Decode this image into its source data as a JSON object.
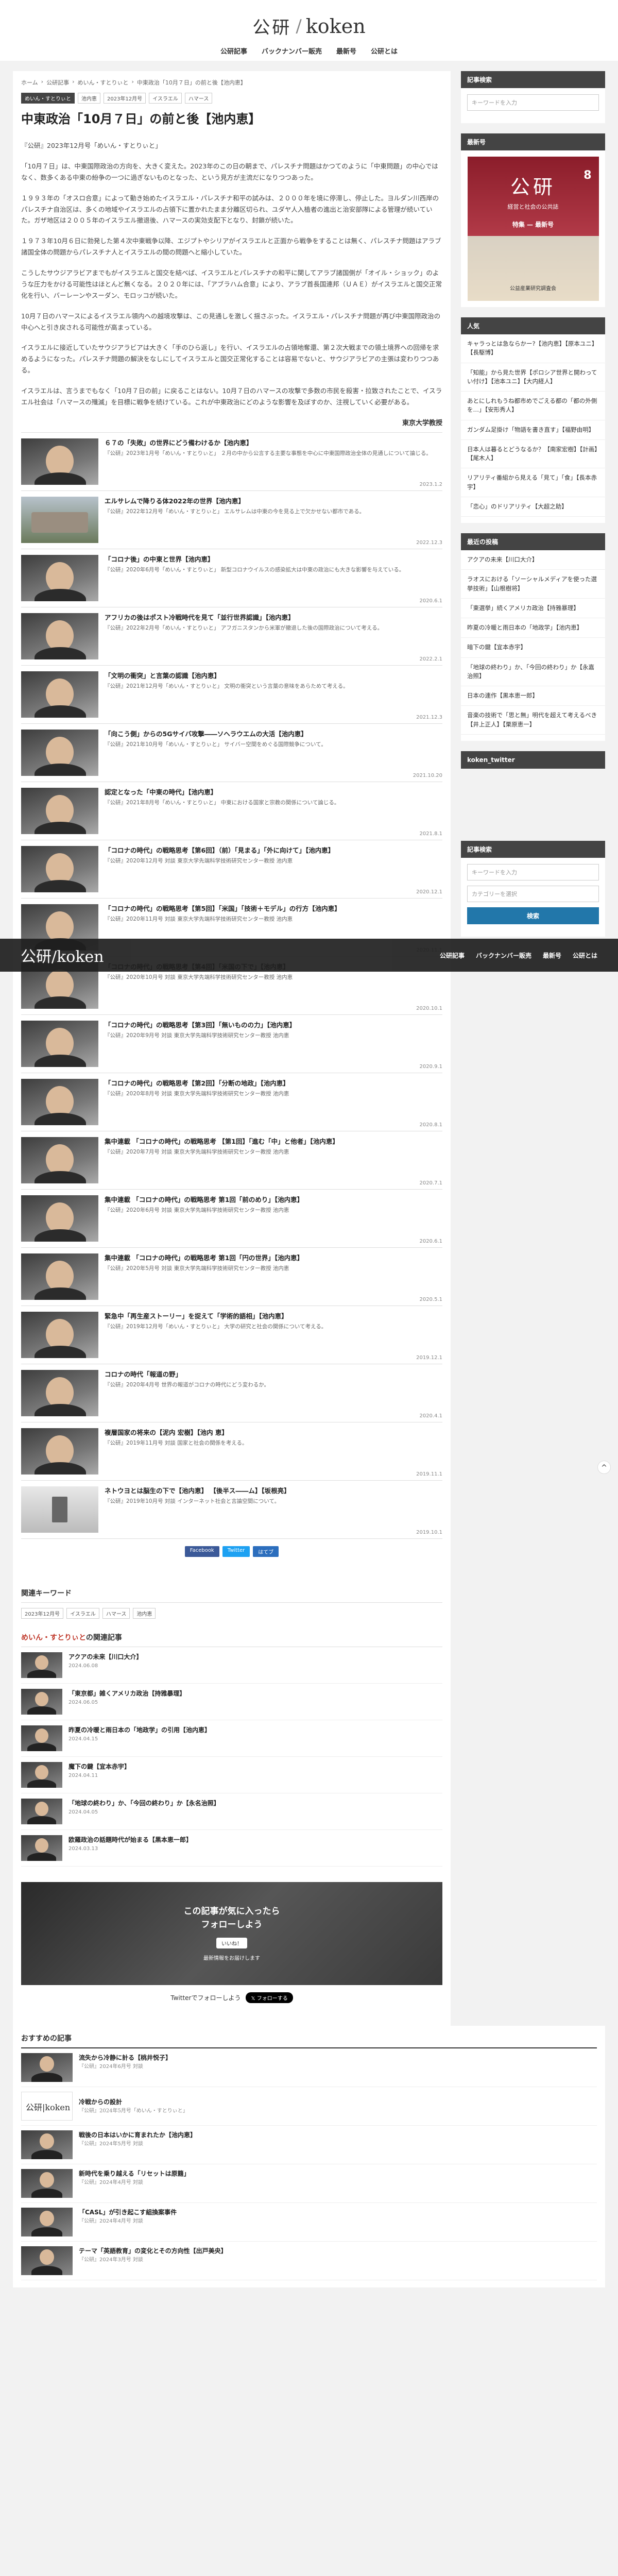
{
  "site": {
    "logo_mark": "公研",
    "logo_sep": "/",
    "logo_text": "koken"
  },
  "nav": [
    "公研記事",
    "バックナンバー販売",
    "最新号",
    "公研とは"
  ],
  "breadcrumb": [
    "ホーム",
    "公研記事",
    "めいん・すとりぃと",
    "中東政治「10月７日」の前と後【池内恵】"
  ],
  "article": {
    "tags": [
      "めいん・すとりぃと",
      "池内恵",
      "2023年12月号",
      "イスラエル",
      "ハマース"
    ],
    "title": "中東政治「10月７日」の前と後【池内恵】",
    "paragraphs": [
      "『公研』2023年12月号「めいん・すとりぃと」",
      "「10月７日」は、中東国際政治の方向を、大きく変えた。2023年のこの日の朝まで、パレスチナ問題はかつてのように「中東問題」の中心ではなく、数多くある中東の紛争の一つに過ぎないものとなった、という見方が主流だになりつつあった。",
      "１９９３年の「オスロ合意」によって動き始めたイスラエル・パレスチナ和平の試みは、２０００年を境に停滞し、停止した。ヨルダン川西岸のパレスチナ自治区は、多くの地域やイスラエルの占領下に置かれたまま分離区切られ、ユダヤ人入植者の進出と治安部隊による管理が続いていた。ガザ地区は２００５年のイスラエル撤退後、ハマースの実効支配下となり、封鎖が続いた。",
      "１９７３年10月６日に勃発した第４次中東戦争以降、エジプトやシリアがイスラエルと正面から戦争をすることは無く、パレスチナ問題はアラブ諸国全体の問題からパレスチナ人とイスラエルの間の問題へと縮小していた。",
      "こうしたサウジアラビアまでもがイスラエルと国交を結べば、イスラエルとパレスチナの和平に関してアラブ諸国側が「オイル・ショック」のような圧力をかける可能性はほとんど無くなる。２０２０年には、「アブラハム合意」により、アラブ首長国連邦（ＵＡＥ）がイスラエルと国交正常化を行い、バーレーンやスーダン、モロッコが続いた。",
      "10月７日のハマースによるイスラエル領内への越境攻撃は、この見通しを激しく揺さぶった。イスラエル・パレスチナ問題が再び中東国際政治の中心へと引き戻される可能性が高まっている。",
      "イスラエルに接近していたサウジアラビアは大きく「手のひら返し」を行い、イスラエルの占領地奪還、第２次大戦までの領土境界への回帰を求めるようになった。パレスチナ問題の解決をなしにしてイスラエルと国交正常化することは容易でないと、サウジアラビアの主張は変わりつつある。",
      "イスラエルは、言うまでもなく「10月７日の前」に戻ることはない。10月７日のハマースの攻撃で多数の市民を殺害・拉致されたことで、イスラエル社会は「ハマースの殲滅」を目標に戦争を続けている。これが中東政治にどのような影響を及ぼすのか、注視していく必要がある。"
    ],
    "author": "東京大学教授"
  },
  "related": [
    {
      "title": "６７の「失敗」の世界にどう備わけるか【池内恵】",
      "desc": "『公研』2023年1月号「めいん・すとりぃと」 ２月の中から公言する主要な事態を中心に中東国際政治全体の見通しについて論じる。",
      "date": "2023.1.2",
      "kind": "face"
    },
    {
      "title": "エルサレムで降りる体2022年の世界【池内恵】",
      "desc": "『公研』2022年12月号「めいん・すとりぃと」 エルサレムは中東の今を見る上で欠かせない都市である。",
      "date": "2022.12.3",
      "kind": "photo"
    },
    {
      "title": "「コロナ後」の中東と世界【池内恵】",
      "desc": "『公研』2020年6月号「めいん・すとりぃと」 新型コロナウイルスの感染拡大は中東の政治にも大きな影響を与えている。",
      "date": "2020.6.1",
      "kind": "face"
    },
    {
      "title": "アフリカの後はポスト冷戦時代を見て「並行世界認識」【池内恵】",
      "desc": "『公研』2022年2月号「めいん・すとりぃと」 アフガニスタンから米軍が撤退した後の国際政治について考える。",
      "date": "2022.2.1",
      "kind": "face"
    },
    {
      "title": "「文明の衝突」と言葉の認識【池内恵】",
      "desc": "『公研』2021年12月号「めいん・すとりぃと」 文明の衝突という言葉の意味をあらためて考える。",
      "date": "2021.12.3",
      "kind": "face"
    },
    {
      "title": "「向こう側」からの5Gサイバ攻撃――ソヘラウエムの大活【池内恵】",
      "desc": "『公研』2021年10月号「めいん・すとりぃと」 サイバー空間をめぐる国際競争について。",
      "date": "2021.10.20",
      "kind": "face"
    },
    {
      "title": "認定となった「中東の時代」【池内恵】",
      "desc": "『公研』2021年8月号「めいん・すとりぃと」 中東における国家と宗教の関係について論じる。",
      "date": "2021.8.1",
      "kind": "face"
    },
    {
      "title": "「コロナの時代」の戦略思考【第6回】（前）「見まる」「外に向けて」【池内恵】",
      "desc": "『公研』2020年12月号 対談 東京大学先端科学技術研究センター教授 池内恵",
      "date": "2020.12.1",
      "kind": "face"
    },
    {
      "title": "「コロナの時代」の戦略思考【第5回】「米国」「技術＋モデル」の行方【池内恵】",
      "desc": "『公研』2020年11月号 対談 東京大学先端科学技術研究センター教授 池内恵",
      "date": "2020.11.1",
      "kind": "face"
    },
    {
      "title": "「コロナの時代」の戦略思考【第4回】「米国の下で」【池内恵】",
      "desc": "『公研』2020年10月号 対談 東京大学先端科学技術研究センター教授 池内恵",
      "date": "2020.10.1",
      "kind": "face"
    },
    {
      "title": "「コロナの時代」の戦略思考【第3回】「無いものの力」【池内恵】",
      "desc": "『公研』2020年9月号 対談 東京大学先端科学技術研究センター教授 池内恵",
      "date": "2020.9.1",
      "kind": "face"
    },
    {
      "title": "「コロナの時代」の戦略思考【第2回】「分断の地政」【池内恵】",
      "desc": "『公研』2020年8月号 対談 東京大学先端科学技術研究センター教授 池内恵",
      "date": "2020.8.1",
      "kind": "face"
    },
    {
      "title": "集中連載 「コロナの時代」の戦略思考 【第1回】「進む「中」と他者」【池内恵】",
      "desc": "『公研』2020年7月号 対談 東京大学先端科学技術研究センター教授 池内恵",
      "date": "2020.7.1",
      "kind": "face"
    },
    {
      "title": "集中連載 「コロナの時代」の戦略思考 第1回「前のめり」【池内恵】",
      "desc": "『公研』2020年6月号 対談 東京大学先端科学技術研究センター教授 池内恵",
      "date": "2020.6.1",
      "kind": "face"
    },
    {
      "title": "集中連載 「コロナの時代」の戦略思考 第1回「円の世界」【池内恵】",
      "desc": "『公研』2020年5月号 対談 東京大学先端科学技術研究センター教授 池内恵",
      "date": "2020.5.1",
      "kind": "face"
    },
    {
      "title": "緊急中「再生産ストーリー」を捉えて「学術的語相」【池内恵】",
      "desc": "『公研』2019年12月号「めいん・すとりぃと」 大学の研究と社会の関係について考える。",
      "date": "2019.12.1",
      "kind": "face"
    },
    {
      "title": "コロナの時代「報道の野」",
      "desc": "『公研』2020年4月号 世界の報道がコロナの時代にどう変わるか。",
      "date": "2020.4.1",
      "kind": "face"
    },
    {
      "title": "複層国家の将来の【泥内 宏樹】【池内 恵】",
      "desc": "『公研』2019年11月号 対談 国家と社会の関係を考える。",
      "date": "2019.11.1",
      "kind": "face"
    },
    {
      "title": "ネトウヨとは脳生の下で【池内恵】 【後半ス――ム】【坂根亮】",
      "desc": "『公研』2019年10月号 対談 インターネット社会と言論空間について。",
      "date": "2019.10.1",
      "kind": "mono"
    }
  ],
  "share": {
    "fb": "Facebook",
    "tw": "Twitter",
    "hb": "はてブ"
  },
  "keywords": {
    "head": "関連キーワード",
    "tags": [
      "2023年12月号",
      "イスラエル",
      "ハマース",
      "池内恵"
    ]
  },
  "related2": {
    "head_link": "めいん・すとりぃと",
    "head_suffix": "の関連記事",
    "items": [
      {
        "title": "アクアの未来【川口大介】",
        "date": "2024.06.08"
      },
      {
        "title": "「東京都」雑くアメリカ政治【持雅暴理】",
        "date": "2024.06.05"
      },
      {
        "title": "昨夏の冷暖と雨日本の「地政学」の引用【池内恵】",
        "date": "2024.04.15"
      },
      {
        "title": "魔下の鍵【宜本赤宇】",
        "date": "2024.04.11"
      },
      {
        "title": "「地球の終わり」か、「今回の終わり」か【永名治照】",
        "date": "2024.04.05"
      },
      {
        "title": "欧羅政治の話題時代が始まる【黒本恵一郎】",
        "date": "2024.03.13"
      }
    ]
  },
  "follow": {
    "line1": "この記事が気に入ったら",
    "line2": "フォローしよう",
    "like": "いいね！",
    "sub": "最新情報をお届けします"
  },
  "twitter_follow": {
    "text": "Twitterでフォローしよう",
    "button": "𝕏 フォローする"
  },
  "recommended": {
    "head": "おすすめの記事",
    "items": [
      {
        "title": "流失から冷静に計る【桃井悦子】",
        "desc": "『公研』2024年6月号 対談",
        "kind": "face"
      },
      {
        "title": "冷戦からの設計",
        "desc": "『公研』2024年5月号「めいん・すとりぃと」",
        "kind": "logo"
      },
      {
        "title": "戦後の日本はいかに育まれたか【池内恵】",
        "desc": "『公研』2024年5月号 対談",
        "kind": "face"
      },
      {
        "title": "新時代を乗り越える「リセットは原籍」",
        "desc": "『公研』2024年4月号 対談",
        "kind": "face"
      },
      {
        "title": "「CASL」が引き起こす組換案事件",
        "desc": "『公研』2024年4月号 対談",
        "kind": "face"
      },
      {
        "title": "テーマ「英語教育」の変化とその方向性【出戸美央】",
        "desc": "『公研』2024年3月号 対談",
        "kind": "face"
      }
    ]
  },
  "sidebar": {
    "search_head": "記事検索",
    "search_placeholder": "キーワードを入力",
    "latest_head": "最新号",
    "mag": {
      "title": "公研",
      "subtitle": "経営と社会の公共誌",
      "num": "8",
      "feature": "特集 — 最新号",
      "footer": "公益産業研究調査会"
    },
    "popular_head": "人気",
    "popular": [
      {
        "text": "キャラっとは急ならかー?【池内恵】【原本ユニ】【長駆博】",
        "date": ""
      },
      {
        "text": "「知能」から見た世界【ポロシア世界と開わってい付け】【池本ユニ】【大内経人】",
        "date": ""
      },
      {
        "text": "あとにしれもうね都市めでごえる都の「都の外側を…」【安形秀人】",
        "date": ""
      },
      {
        "text": "ガンダム足掛け「物語を書き直す」【福野由明】",
        "date": ""
      },
      {
        "text": "日本人は暮るとどうなるか？【南家宏樹】【計画】【尾木人】",
        "date": ""
      },
      {
        "text": "リアリティ番組から見える「見て」「食」【長本赤宇】",
        "date": ""
      },
      {
        "text": "「恋心」のドリアリティ【大超之助】",
        "date": ""
      }
    ],
    "recent_head": "最近の投稿",
    "recent": [
      {
        "text": "アクアの未来【川口大介】",
        "date": ""
      },
      {
        "text": "ラオスにおける「ソーシャルメディアを使った選挙技術」【山根樹将】",
        "date": ""
      },
      {
        "text": "「東選挙」続くアメリカ政治【持雅暴理】",
        "date": ""
      },
      {
        "text": "昨夏の冷暖と雨日本の「地政学」【池内恵】",
        "date": ""
      },
      {
        "text": "暗下の鍵【宜本赤宇】",
        "date": ""
      },
      {
        "text": "「地球の終わり」か、「今回の終わり」か【永嘉治照】",
        "date": ""
      },
      {
        "text": "日本の連作【黒本恵一郎】",
        "date": ""
      },
      {
        "text": "音楽の技術で「思と無」明代を超えて考えるべき【井上正人】【栗原恵一】",
        "date": ""
      }
    ],
    "twitter_btn": "koken_twitter",
    "search2_head": "記事検索",
    "search2_placeholder": "キーワードを入力",
    "category_placeholder": "カテゴリーを選択",
    "search_btn": "検索"
  },
  "sticky": {
    "logo": "公研/koken"
  }
}
